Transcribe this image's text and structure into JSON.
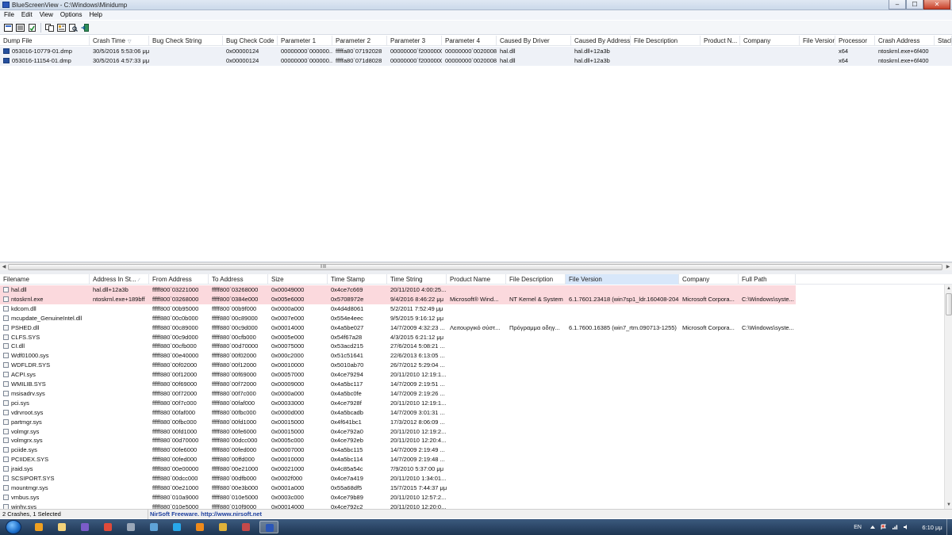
{
  "window": {
    "title": "BlueScreenView  -  C:\\Windows\\Minidump",
    "minimize": "‒",
    "maximize": "☐",
    "close": "✕"
  },
  "menu": [
    "File",
    "Edit",
    "View",
    "Options",
    "Help"
  ],
  "toolbar": [
    "save-icon",
    "properties-icon",
    "refresh-icon",
    "copy-icon",
    "report-icon",
    "search-icon",
    "exit-icon"
  ],
  "upper": {
    "columns": [
      {
        "label": "Dump File",
        "w": 113
      },
      {
        "label": "Crash Time",
        "w": 75,
        "sort": "▽"
      },
      {
        "label": "Bug Check String",
        "w": 93
      },
      {
        "label": "Bug Check Code",
        "w": 69
      },
      {
        "label": "Parameter 1",
        "w": 69
      },
      {
        "label": "Parameter 2",
        "w": 69
      },
      {
        "label": "Parameter 3",
        "w": 69
      },
      {
        "label": "Parameter 4",
        "w": 69
      },
      {
        "label": "Caused By Driver",
        "w": 94
      },
      {
        "label": "Caused By Address",
        "w": 75
      },
      {
        "label": "File Description",
        "w": 88
      },
      {
        "label": "Product N...",
        "w": 50
      },
      {
        "label": "Company",
        "w": 75
      },
      {
        "label": "File Version",
        "w": 45
      },
      {
        "label": "Processor",
        "w": 50
      },
      {
        "label": "Crash Address",
        "w": 75
      },
      {
        "label": "Stack",
        "w": 22
      }
    ],
    "rows": [
      [
        "053016-10779-01.dmp",
        "30/5/2016 5:53:06 μμ",
        "",
        "0x00000124",
        "00000000`000000...",
        "fffffa80`07192028",
        "00000000`f2000000",
        "00000000`0020008f",
        "hal.dll",
        "hal.dll+12a3b",
        "",
        "",
        "",
        "",
        "x64",
        "ntoskrnl.exe+6f400",
        ""
      ],
      [
        "053016-11154-01.dmp",
        "30/5/2016 4:57:33 μμ",
        "",
        "0x00000124",
        "00000000`000000...",
        "fffffa80`071d8028",
        "00000000`f2000000",
        "00000000`0020008f",
        "hal.dll",
        "hal.dll+12a3b",
        "",
        "",
        "",
        "",
        "x64",
        "ntoskrnl.exe+6f400",
        ""
      ]
    ]
  },
  "lower": {
    "columns": [
      {
        "label": "Filename",
        "w": 113
      },
      {
        "label": "Address In St...",
        "w": 75,
        "sort": "∕"
      },
      {
        "label": "From Address",
        "w": 75
      },
      {
        "label": "To Address",
        "w": 75
      },
      {
        "label": "Size",
        "w": 75
      },
      {
        "label": "Time Stamp",
        "w": 75
      },
      {
        "label": "Time String",
        "w": 75
      },
      {
        "label": "Product Name",
        "w": 75
      },
      {
        "label": "File Description",
        "w": 75
      },
      {
        "label": "File Version",
        "w": 143
      },
      {
        "label": "Company",
        "w": 75
      },
      {
        "label": "Full Path",
        "w": 72
      }
    ],
    "rows": [
      [
        "hal.dll",
        "hal.dll+12a3b",
        "fffff800`03221000",
        "fffff800`03268000",
        "0x00049000",
        "0x4ce7c669",
        "20/11/2010 4:00:25...",
        "",
        "",
        "",
        "",
        ""
      ],
      [
        "ntoskrnl.exe",
        "ntoskrnl.exe+189bff",
        "fffff800`03268000",
        "fffff800`0384e000",
        "0x005e6000",
        "0x5708972e",
        "9/4/2016 8:46:22 μμ",
        "Microsoft® Wind...",
        "NT Kernel & System",
        "6.1.7601.23418 (win7sp1_ldr.160408-2045)",
        "Microsoft Corpora...",
        "C:\\Windows\\syste..."
      ],
      [
        "kdcom.dll",
        "",
        "fffff800`00b95000",
        "fffff800`00b9f000",
        "0x0000a000",
        "0x4d4d8061",
        "5/2/2011 7:52:49 μμ",
        "",
        "",
        "",
        "",
        ""
      ],
      [
        "mcupdate_GenuineIntel.dll",
        "",
        "fffff880`00c0b000",
        "fffff880`00c89000",
        "0x0007e000",
        "0x554e4eec",
        "9/5/2015 9:16:12 μμ",
        "",
        "",
        "",
        "",
        ""
      ],
      [
        "PSHED.dll",
        "",
        "fffff880`00c89000",
        "fffff880`00c9d000",
        "0x00014000",
        "0x4a5be027",
        "14/7/2009 4:32:23 ...",
        "Λειτουργικό σύστ...",
        "Πρόγραμμα οδηγ...",
        "6.1.7600.16385 (win7_rtm.090713-1255)",
        "Microsoft Corpora...",
        "C:\\Windows\\syste..."
      ],
      [
        "CLFS.SYS",
        "",
        "fffff880`00c9d000",
        "fffff880`00cfb000",
        "0x0005e000",
        "0x54f67a28",
        "4/3/2015 6:21:12 μμ",
        "",
        "",
        "",
        "",
        ""
      ],
      [
        "CI.dll",
        "",
        "fffff880`00cfb000",
        "fffff880`00d70000",
        "0x00075000",
        "0x53acd215",
        "27/6/2014 5:08:21 ...",
        "",
        "",
        "",
        "",
        ""
      ],
      [
        "Wdf01000.sys",
        "",
        "fffff880`00e40000",
        "fffff880`00f02000",
        "0x000c2000",
        "0x51c51641",
        "22/6/2013 6:13:05 ...",
        "",
        "",
        "",
        "",
        ""
      ],
      [
        "WDFLDR.SYS",
        "",
        "fffff880`00f02000",
        "fffff880`00f12000",
        "0x00010000",
        "0x5010ab70",
        "26/7/2012 5:29:04 ...",
        "",
        "",
        "",
        "",
        ""
      ],
      [
        "ACPI.sys",
        "",
        "fffff880`00f12000",
        "fffff880`00f69000",
        "0x00057000",
        "0x4ce79294",
        "20/11/2010 12:19:1...",
        "",
        "",
        "",
        "",
        ""
      ],
      [
        "WMILIB.SYS",
        "",
        "fffff880`00f69000",
        "fffff880`00f72000",
        "0x00009000",
        "0x4a5bc117",
        "14/7/2009 2:19:51 ...",
        "",
        "",
        "",
        "",
        ""
      ],
      [
        "msisadrv.sys",
        "",
        "fffff880`00f72000",
        "fffff880`00f7c000",
        "0x0000a000",
        "0x4a5bc0fe",
        "14/7/2009 2:19:26 ...",
        "",
        "",
        "",
        "",
        ""
      ],
      [
        "pci.sys",
        "",
        "fffff880`00f7c000",
        "fffff880`00faf000",
        "0x00033000",
        "0x4ce7928f",
        "20/11/2010 12:19:1...",
        "",
        "",
        "",
        "",
        ""
      ],
      [
        "vdrvroot.sys",
        "",
        "fffff880`00faf000",
        "fffff880`00fbc000",
        "0x0000d000",
        "0x4a5bcadb",
        "14/7/2009 3:01:31 ...",
        "",
        "",
        "",
        "",
        ""
      ],
      [
        "partmgr.sys",
        "",
        "fffff880`00fbc000",
        "fffff880`00fd1000",
        "0x00015000",
        "0x4f641bc1",
        "17/3/2012 8:06:09 ...",
        "",
        "",
        "",
        "",
        ""
      ],
      [
        "volmgr.sys",
        "",
        "fffff880`00fd1000",
        "fffff880`00fe6000",
        "0x00015000",
        "0x4ce792a0",
        "20/11/2010 12:19:2...",
        "",
        "",
        "",
        "",
        ""
      ],
      [
        "volmgrx.sys",
        "",
        "fffff880`00d70000",
        "fffff880`00dcc000",
        "0x0005c000",
        "0x4ce792eb",
        "20/11/2010 12:20:4...",
        "",
        "",
        "",
        "",
        ""
      ],
      [
        "pciide.sys",
        "",
        "fffff880`00fe6000",
        "fffff880`00fed000",
        "0x00007000",
        "0x4a5bc115",
        "14/7/2009 2:19:49 ...",
        "",
        "",
        "",
        "",
        ""
      ],
      [
        "PCIIDEX.SYS",
        "",
        "fffff880`00fed000",
        "fffff880`00ffd000",
        "0x00010000",
        "0x4a5bc114",
        "14/7/2009 2:19:48 ...",
        "",
        "",
        "",
        "",
        ""
      ],
      [
        "jraid.sys",
        "",
        "fffff880`00e00000",
        "fffff880`00e21000",
        "0x00021000",
        "0x4c85a54c",
        "7/9/2010 5:37:00 μμ",
        "",
        "",
        "",
        "",
        ""
      ],
      [
        "SCSIPORT.SYS",
        "",
        "fffff880`00dcc000",
        "fffff880`00dfb000",
        "0x0002f000",
        "0x4ce7a419",
        "20/11/2010 1:34:01...",
        "",
        "",
        "",
        "",
        ""
      ],
      [
        "mountmgr.sys",
        "",
        "fffff880`00e21000",
        "fffff880`00e3b000",
        "0x0001a000",
        "0x55a68df5",
        "15/7/2015 7:44:37 μμ",
        "",
        "",
        "",
        "",
        ""
      ],
      [
        "vmbus.sys",
        "",
        "fffff880`010a9000",
        "fffff880`010e5000",
        "0x0003c000",
        "0x4ce79b89",
        "20/11/2010 12:57:2...",
        "",
        "",
        "",
        "",
        ""
      ],
      [
        "winhv.sys",
        "",
        "fffff880`010e5000",
        "fffff880`010f9000",
        "0x00014000",
        "0x4ce792c2",
        "20/11/2010 12:20:0...",
        "",
        "",
        "",
        "",
        ""
      ]
    ],
    "highlight_color": "#fbd9dd",
    "highlight_rows": [
      0,
      1
    ]
  },
  "status": {
    "left": "2 Crashes, 1 Selected",
    "middle": "NirSoft Freeware.  http://www.nirsoft.net"
  },
  "taskbar": {
    "apps": [
      {
        "name": "media-player-icon",
        "color": "#f0a020"
      },
      {
        "name": "explorer-icon",
        "color": "#f3d27a"
      },
      {
        "name": "viber-icon",
        "color": "#7b5cc9"
      },
      {
        "name": "chrome-icon",
        "color": "#e04a3a"
      },
      {
        "name": "utility-icon",
        "color": "#9aa7b8"
      },
      {
        "name": "network-icon",
        "color": "#5fa3d8"
      },
      {
        "name": "skype-icon",
        "color": "#28a8ea"
      },
      {
        "name": "vlc-icon",
        "color": "#f08a1a"
      },
      {
        "name": "chrome2-icon",
        "color": "#e0b23a"
      },
      {
        "name": "greek-flag-icon",
        "color": "#c6494a"
      },
      {
        "name": "bluescreenview-icon",
        "color": "#2a56b8"
      }
    ],
    "language": "EN",
    "clock": "6:10 μμ"
  }
}
